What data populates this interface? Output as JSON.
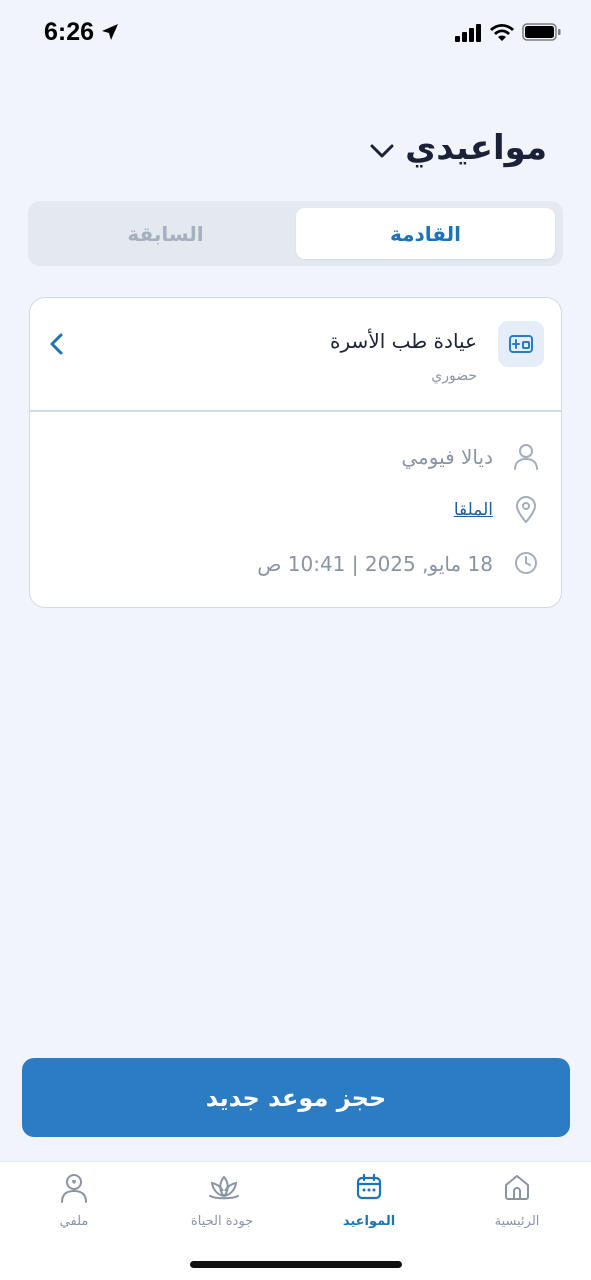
{
  "status_bar": {
    "time": "6:26"
  },
  "header": {
    "title": "مواعيدي"
  },
  "tabs": {
    "upcoming": "القادمة",
    "past": "السابقة"
  },
  "appointment": {
    "clinic": "عيادة طب الأسرة",
    "visit_type": "حضوري",
    "doctor": "ديالا فيومي",
    "location": "الملقا",
    "datetime": "18 مايو, 2025 | 10:41 ص"
  },
  "book_button": {
    "label": "حجز موعد جديد"
  },
  "bottom_nav": {
    "home": "الرئيسية",
    "appointments": "المواعيد",
    "quality_of_life": "جودة الحياة",
    "profile": "ملفي"
  },
  "colors": {
    "accent": "#2b7cc2",
    "active_tab": "#1c73b8",
    "background": "#f1f5fb"
  },
  "icons": {
    "clinic": "clinic-building-icon",
    "doctor": "person-icon",
    "location": "map-pin-icon",
    "time": "clock-icon"
  }
}
